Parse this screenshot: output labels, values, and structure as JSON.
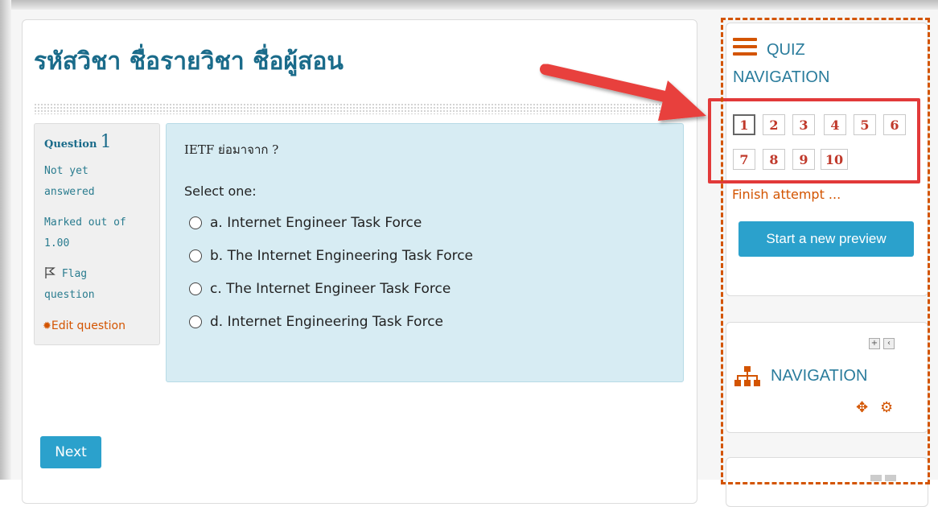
{
  "course": {
    "title": "รหัสวิชา ชื่อรายวิชา ชื่อผู้สอน"
  },
  "question": {
    "label": "Question",
    "number": "1",
    "state_line1": "Not yet",
    "state_line2": "answered",
    "grade_line1": "Marked out of",
    "grade_line2": "1.00",
    "flag_line1": "Flag",
    "flag_line2": "question",
    "edit_label": "Edit question",
    "text": "IETF ย่อมาจาก ?",
    "prompt": "Select one:",
    "options": [
      "a. Internet Engineer Task Force",
      "b. The Internet Engineering Task Force",
      "c. The Internet Engineer Task Force",
      "d. Internet Engineering Task Force"
    ]
  },
  "buttons": {
    "next_label": "Next"
  },
  "quiz_nav": {
    "title_line1": "QUIZ",
    "title_line2": "NAVIGATION",
    "questions": [
      "1",
      "2",
      "3",
      "4",
      "5",
      "6",
      "7",
      "8",
      "9",
      "10"
    ],
    "current": "1",
    "finish_label": "Finish attempt ...",
    "preview_label": "Start a new preview"
  },
  "navigation_block": {
    "title": "NAVIGATION"
  },
  "colors": {
    "accent": "#d35400",
    "title_blue": "#1a6b8a",
    "button_blue": "#2ba1cc",
    "highlight_red": "#e23a3a",
    "question_bg": "#d7ecf3"
  },
  "icons": [
    "hamburger-icon",
    "flag-icon",
    "gear-icon",
    "sitemap-icon",
    "move-icon",
    "cogs-icon",
    "dock-icon",
    "collapse-icon",
    "arrow-annotation"
  ]
}
